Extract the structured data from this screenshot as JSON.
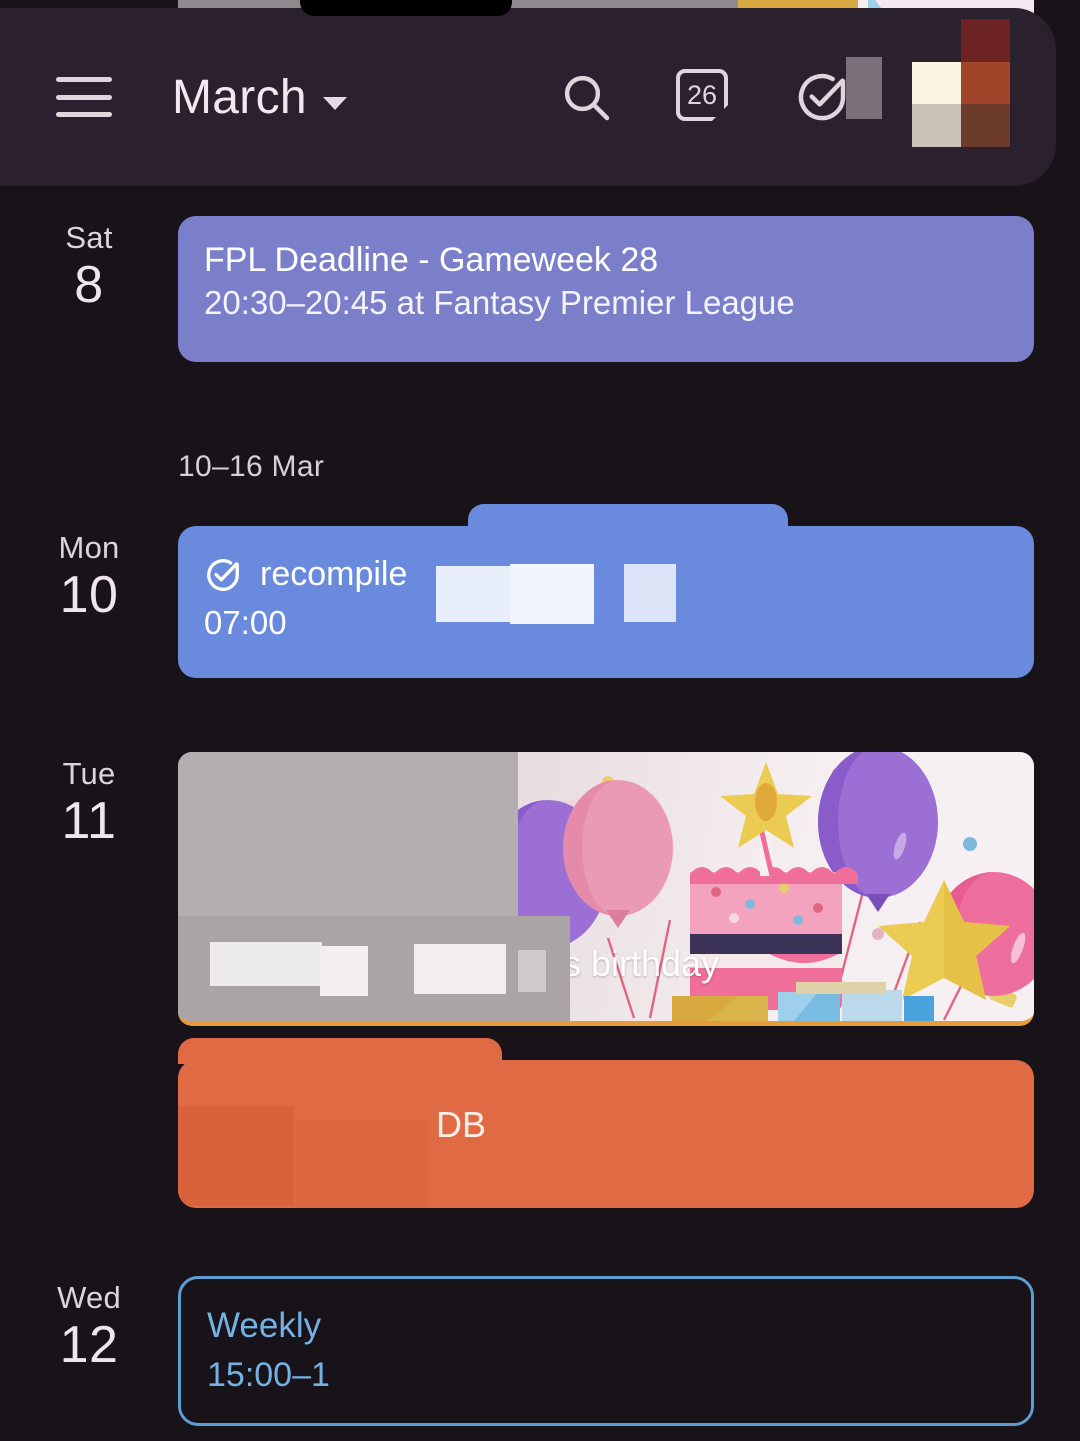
{
  "app": {
    "background_color": "#181219",
    "topbar_color": "#2b212e"
  },
  "topbar": {
    "menu_label": "menu",
    "title": "March",
    "caret": "▾",
    "search_label": "Search",
    "today_icon_label": "26",
    "tasks_label": "Tasks",
    "avatar_label": "Account"
  },
  "agenda": {
    "partial_event": {
      "prefix": "A",
      "title": "'s birthday",
      "color": "#e79a3c"
    },
    "weeks": [
      {
        "header": null,
        "days": [
          {
            "dow": "Sat",
            "num": "8",
            "events": [
              {
                "kind": "event",
                "style": "purple",
                "title": "FPL Deadline - Gameweek 28",
                "subtitle": "20:30–20:45 at Fantasy Premier League",
                "color": "#7b7fc9"
              }
            ]
          }
        ]
      },
      {
        "header": "10–16 Mar",
        "days": [
          {
            "dow": "Mon",
            "num": "10",
            "events": [
              {
                "kind": "task",
                "style": "bluetask",
                "title": "recompile",
                "subtitle": "07:00",
                "color": "#6a8bdd",
                "icon": "task-check-icon"
              }
            ]
          },
          {
            "dow": "Tue",
            "num": "11",
            "events": [
              {
                "kind": "birthday",
                "style": "birthday",
                "title": "s birthday",
                "subtitle": "",
                "color": "#e79a3c"
              },
              {
                "kind": "event",
                "style": "orange",
                "title": "DB",
                "subtitle": "",
                "color": "#e06a43"
              }
            ]
          },
          {
            "dow": "Wed",
            "num": "12",
            "events": [
              {
                "kind": "event",
                "style": "outlined",
                "title": "Weekly",
                "subtitle": "15:00–1",
                "color": "#5d9ed2"
              }
            ]
          }
        ]
      }
    ]
  },
  "colors": {
    "purple_event": "#7b7fc9",
    "blue_task": "#6a8bdd",
    "orange_event": "#e06a43",
    "outlined_event": "#5d9ed2",
    "birthday_accent": "#e79a3c",
    "text_primary": "#eee6ec",
    "text_secondary": "#d8d0d7"
  }
}
